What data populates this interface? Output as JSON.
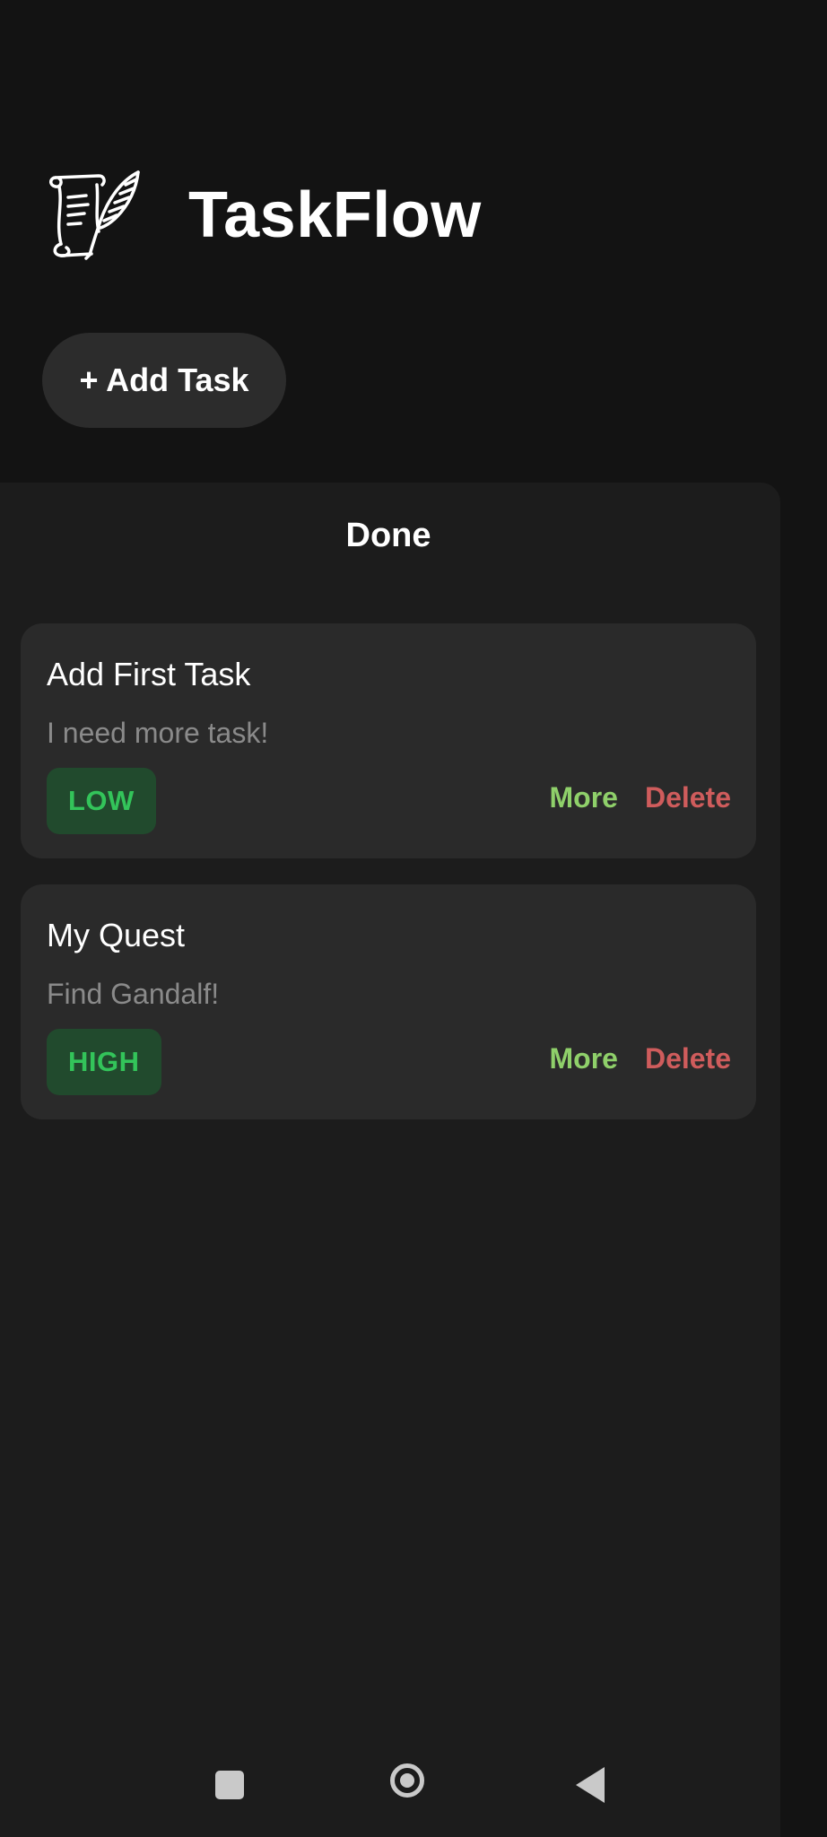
{
  "app": {
    "title": "TaskFlow",
    "logo_icon": "scroll-quill-icon"
  },
  "toolbar": {
    "add_task_label": "+ Add Task"
  },
  "column": {
    "title": "Done",
    "cards": [
      {
        "title": "Add First Task",
        "description": "I need more task!",
        "priority": "LOW",
        "more_label": "More",
        "delete_label": "Delete"
      },
      {
        "title": "My Quest",
        "description": "Find Gandalf!",
        "priority": "HIGH",
        "more_label": "More",
        "delete_label": "Delete"
      }
    ]
  },
  "colors": {
    "background": "#131313",
    "panel": "#1c1c1c",
    "card": "#2a2a2a",
    "priority_badge_bg": "#214a2d",
    "priority_badge_text": "#33c45a",
    "more_link": "#8fd06a",
    "delete_link": "#cf5c5c"
  },
  "navigation_bar": {
    "icons": [
      "recents-square-icon",
      "home-circle-icon",
      "back-triangle-icon"
    ]
  }
}
